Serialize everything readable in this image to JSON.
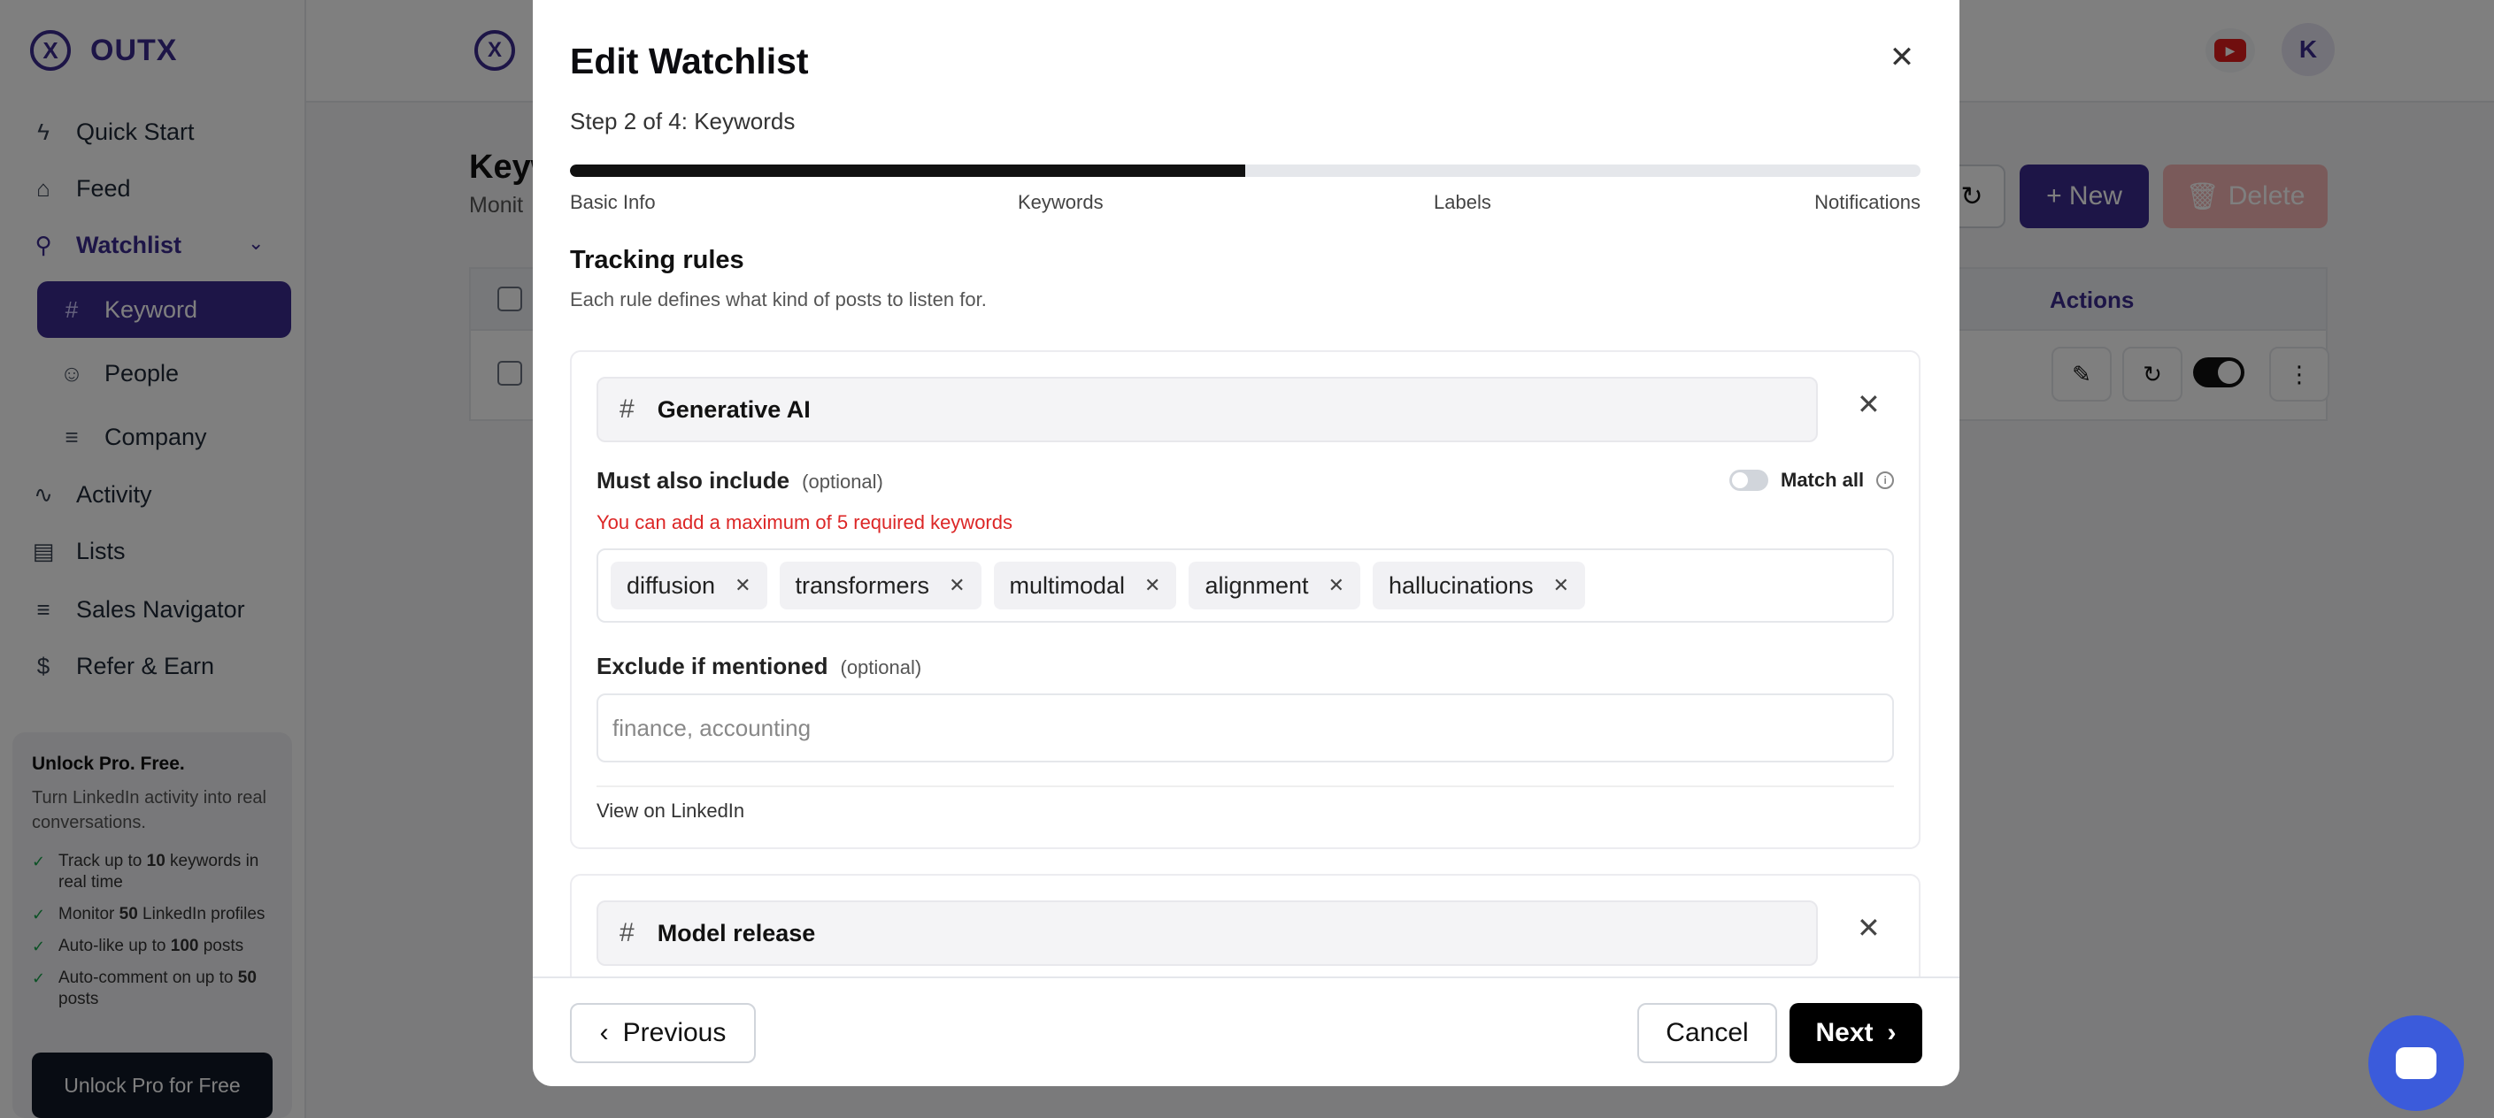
{
  "app": {
    "brand": "OUTX",
    "nav": {
      "quick_start": "Quick Start",
      "feed": "Feed",
      "watchlist": "Watchlist",
      "keyword": "Keyword",
      "people": "People",
      "company": "Company",
      "activity": "Activity",
      "lists": "Lists",
      "sales_navigator": "Sales Navigator",
      "refer_earn": "Refer & Earn"
    },
    "promo": {
      "title": "Unlock Pro. Free.",
      "subtitle": "Turn LinkedIn activity into real conversations.",
      "items": [
        {
          "pre": "Track up to ",
          "bold": "10",
          "post": " keywords in real time"
        },
        {
          "pre": "Monitor ",
          "bold": "50",
          "post": " LinkedIn profiles"
        },
        {
          "pre": "Auto-like up to ",
          "bold": "100",
          "post": " posts"
        },
        {
          "pre": "Auto-comment on up to ",
          "bold": "50",
          "post": " posts"
        }
      ],
      "button": "Unlock Pro for Free"
    },
    "avatar_initial": "K",
    "page_title": "Keyw",
    "page_subtitle": "Monit",
    "new_button": "+ New",
    "delete_button": "Delete",
    "table_actions_header": "Actions",
    "accent_color": "#3b2a8f"
  },
  "modal": {
    "title": "Edit Watchlist",
    "step_text": "Step 2 of 4: Keywords",
    "progress_fraction": 0.5,
    "steps": [
      "Basic Info",
      "Keywords",
      "Labels",
      "Notifications"
    ],
    "section_title": "Tracking rules",
    "section_subtitle": "Each rule defines what kind of posts to listen for.",
    "rules": [
      {
        "name": "Generative AI",
        "must_include_label": "Must also include",
        "optional_label": "(optional)",
        "match_all_label": "Match all",
        "match_all_enabled": false,
        "error": "You can add a maximum of 5 required keywords",
        "keywords": [
          "diffusion",
          "transformers",
          "multimodal",
          "alignment",
          "hallucinations"
        ],
        "exclude_label": "Exclude if mentioned",
        "exclude_placeholder": "finance, accounting",
        "exclude_value": "",
        "link_text": "View on LinkedIn"
      },
      {
        "name": "Model release"
      }
    ],
    "footer": {
      "previous": "Previous",
      "cancel": "Cancel",
      "next": "Next"
    }
  }
}
